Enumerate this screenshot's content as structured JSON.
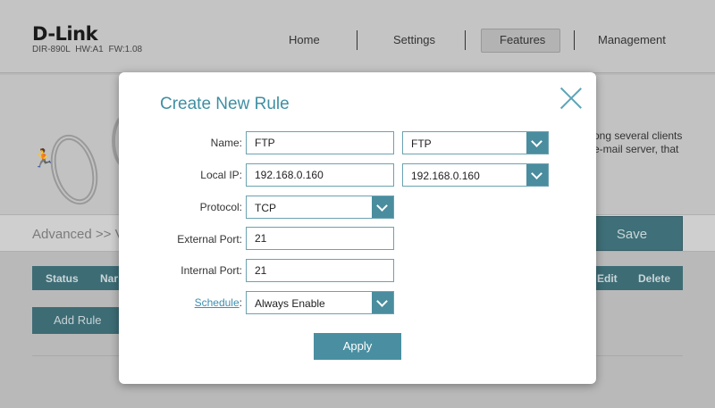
{
  "header": {
    "logo": "D-Link",
    "model": "DIR-890L",
    "hw": "HW:A1",
    "fw": "FW:1.08",
    "nav": [
      "Home",
      "Settings",
      "Features",
      "Management"
    ],
    "active_nav": "Features"
  },
  "hero": {
    "line1": "ong several clients",
    "line2": "e-mail server, that"
  },
  "breadcrumb": "Advanced >> V",
  "save_label": "Save",
  "table": {
    "headers": {
      "status": "Status",
      "name": "Nar",
      "edit": "Edit",
      "delete": "Delete"
    }
  },
  "add_rule_label": "Add Rule",
  "modal": {
    "title": "Create New Rule",
    "name_label": "Name:",
    "name_value": "FTP",
    "name_select": "FTP",
    "local_ip_label": "Local IP:",
    "local_ip_value": "192.168.0.160",
    "local_ip_select": "192.168.0.160",
    "protocol_label": "Protocol:",
    "protocol_value": "TCP",
    "external_port_label": "External Port:",
    "external_port_value": "21",
    "internal_port_label": "Internal Port:",
    "internal_port_value": "21",
    "schedule_label": "Schedule",
    "schedule_colon": ":",
    "schedule_value": "Always Enable",
    "apply_label": "Apply"
  },
  "colors": {
    "accent": "#4a8d9e",
    "title": "#3f8fa2",
    "link": "#3d8fb0"
  }
}
